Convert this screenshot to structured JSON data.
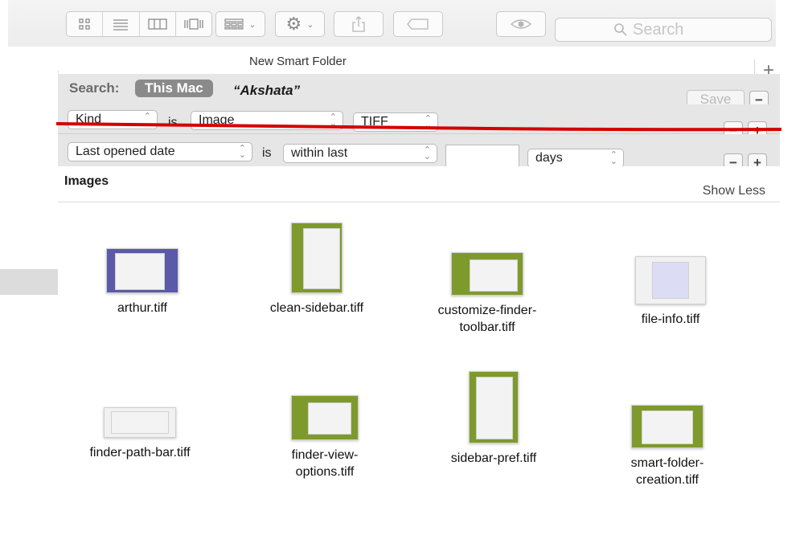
{
  "toolbar": {
    "search_placeholder": "Search",
    "view_buttons": [
      "icon-view",
      "list-view",
      "column-view",
      "coverflow-view"
    ],
    "arrange_icon": "arrange-grid-icon",
    "action_icon": "gear-icon"
  },
  "window": {
    "title": "New Smart Folder",
    "new_tab_label": "+"
  },
  "search_scope": {
    "label": "Search:",
    "selected_scope": "This Mac",
    "other_scope": "“Akshata”",
    "save_label": "Save",
    "minus_label": "−"
  },
  "rules": [
    {
      "attribute": "Kind",
      "operator": "is",
      "value": "Image",
      "subvalue": "TIFF"
    },
    {
      "attribute": "Last opened date",
      "operator": "is",
      "value": "within last",
      "amount": "",
      "unit": "days"
    }
  ],
  "rule_buttons": {
    "minus": "−",
    "plus": "+"
  },
  "annotation": {
    "underline_color": "#d40000"
  },
  "results": {
    "section_title": "Images",
    "toggle_label": "Show Less",
    "files": [
      {
        "name_line1": "arthur.tiff",
        "name_line2": ""
      },
      {
        "name_line1": "clean-sidebar.tiff",
        "name_line2": ""
      },
      {
        "name_line1": "customize-finder-",
        "name_line2": "toolbar.tiff"
      },
      {
        "name_line1": "file-info.tiff",
        "name_line2": ""
      },
      {
        "name_line1": "finder-path-bar.tiff",
        "name_line2": ""
      },
      {
        "name_line1": "finder-view-",
        "name_line2": "options.tiff"
      },
      {
        "name_line1": "sidebar-pref.tiff",
        "name_line2": ""
      },
      {
        "name_line1": "smart-folder-",
        "name_line2": "creation.tiff"
      }
    ]
  }
}
